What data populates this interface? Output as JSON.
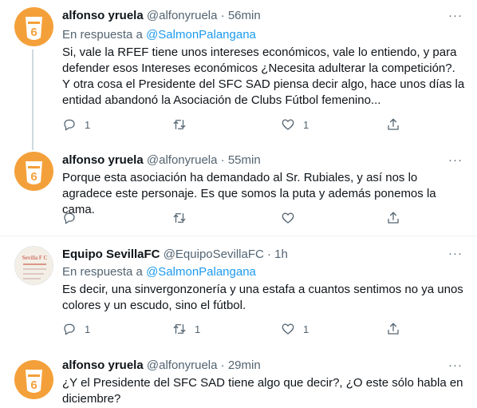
{
  "tweets": [
    {
      "name": "alfonso yruela",
      "handle": "@alfonyruela",
      "sep": "·",
      "time": "56min",
      "reply_prefix": "En respuesta a",
      "reply_mention": "@SalmonPalangana",
      "text": "Si, vale la RFEF tiene unos intereses económicos, vale lo entiendo, y para defender esos Intereses económicos ¿Necesita adulterar la competición?. Y otra cosa el Presidente del SFC SAD piensa decir algo, hace unos días la entidad abandonó la Asociación de Clubs Fútbol femenino...",
      "replies": "1",
      "retweets": "",
      "likes": "1",
      "avatar": "orange-6-logo"
    },
    {
      "name": "alfonso yruela",
      "handle": "@alfonyruela",
      "sep": "·",
      "time": "55min",
      "text": "Porque esta asociación ha demandado al Sr. Rubiales, y así nos lo agradece este personaje. Es que somos la puta y además ponemos la cama.",
      "replies": "",
      "retweets": "",
      "likes": "",
      "avatar": "orange-6-logo"
    },
    {
      "name": "Equipo SevillaFC",
      "handle": "@EquipoSevillaFC",
      "sep": "·",
      "time": "1h",
      "reply_prefix": "En respuesta a",
      "reply_mention": "@SalmonPalangana",
      "text": "Es decir, una sinvergonzonería y una estafa a cuantos sentimos no ya unos colores y un escudo, sino el fútbol.",
      "replies": "1",
      "retweets": "1",
      "likes": "1",
      "avatar": "sevilla-fc-crest",
      "avatar_text": "Sevilla F C"
    },
    {
      "name": "alfonso yruela",
      "handle": "@alfonyruela",
      "sep": "·",
      "time": "29min",
      "text": "¿Y el Presidente del SFC SAD tiene algo que decir?, ¿O este sólo habla en diciembre?",
      "avatar": "orange-6-logo"
    }
  ],
  "more_icon": "···",
  "colors": {
    "accent": "#1d9bf0",
    "secondary": "#536471",
    "orange": "#f4a03a"
  }
}
